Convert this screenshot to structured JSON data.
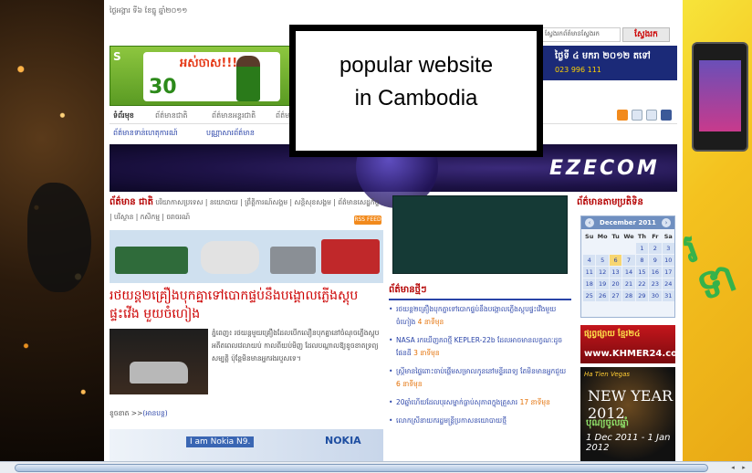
{
  "overlay": {
    "line1": "popular website",
    "line2": "in Cambodia"
  },
  "topbar": {
    "date": "ថ្ងៃអង្គារ ទី៦ ខែធ្នូ ឆ្នាំ២០១១"
  },
  "search": {
    "placeholder": "ស្វែងរកព័ត៌មានស្វែងរក",
    "button": "ស្វែងរក"
  },
  "banner_left": {
    "s": "S",
    "headline": "អស់ចាស!!!",
    "big": "30"
  },
  "banner_right": {
    "line1": "ថ្ងៃទី ៤ មករា ២០១២ តទៅ",
    "line2": "023 996 111"
  },
  "nav": {
    "items": [
      "ទំព័រមុខ",
      "ព័ត៌មានជាតិ",
      "ព័ត៌មានអន្តរជាតិ",
      "ព័ត៌មា"
    ],
    "sub": [
      "ព័ត៌មានទាន់ហេតុការណ៍",
      "បណ្ណាសារព័ត៌មាន"
    ]
  },
  "ezecom": {
    "logo": "EZECOM"
  },
  "left": {
    "cat_title": "ព័ត៌មាន ជាតិ",
    "cat_links": "បរិយាកាសប្រទេស | នយោបាយ | ព្រឹត្តិការណ៍សង្គម | សន្តិសុខសង្គម | ព័ត៌មានសេដ្ឋកិច្ច | បរិស្ថាន | កសិកម្ម | ចរាចរណ៍",
    "rss": "RSS FEED",
    "headline": "រថយន្ត២គ្រឿងបុកគ្នាទៅបោកផ្ទប់នឹងបង្គោលភ្លើងស្តុបផ្ទះវើង មួយចំហៀង",
    "story": "ភ្នំពេញ៖ រថយន្តមួយគ្រឿងដែលបើកលឿនបុកគ្នានៅចំណុចភ្លើងស្តុប អតីតពេលវេលាយប់ កាលពីយប់មិញ ដែលបណ្តាលឱ្យខូចខាតទ្រព្យសម្បត្តិ ប៉ុន្តែមិនមានអ្នករងរបួសទេ។",
    "more_prefix": "ខូចខាត >>",
    "more_link": "(អានបន្ត)",
    "nokia_t1": "I am Nokia N9.",
    "nokia_brand": "NOKIA"
  },
  "middle": {
    "title": "ព័ត៌មានថ្មីៗ",
    "news": [
      {
        "text": "រថយន្ត២គ្រឿងបុកគ្នាទៅបោកផ្ទប់នឹងបង្គោលភ្លើងស្តុបផ្ទះវើងមួយចំហៀង",
        "ago": "4 នាទីមុន"
      },
      {
        "text": "NASA រកឃើញភពថ្មី KEPLER-22b ដែលអាចមានលក្ខណៈដូចផែនដី",
        "ago": "3 នាទីមុន"
      },
      {
        "text": "ស្ត្រីមានផ្ទៃពោះចាប់ផ្តើមសម្រាលកូននៅមន្ទីរពេទ្យ តែមិនមានអ្នកជួយ",
        "ago": "6 នាទីមុន"
      },
      {
        "text": "20ឆ្នាំហើយដែលបុរសម្នាក់ធ្លាប់សុភាពក្នុងគ្រួសារ",
        "ago": "17 នាទីមុន"
      },
      {
        "text": "លោកស្រីនាយករដ្ឋមន្ត្រីប្រកាសនយោបាយថ្មី",
        "ago": ""
      }
    ]
  },
  "right": {
    "title": "ព័ត៌មានតាមប្រតិទិន",
    "calendar": {
      "month": "December 2011",
      "dow": [
        "Su",
        "Mo",
        "Tu",
        "We",
        "Th",
        "Fr",
        "Sa"
      ],
      "days": [
        [
          "",
          "",
          "",
          "",
          "1",
          "2",
          "3"
        ],
        [
          "4",
          "5",
          "6",
          "7",
          "8",
          "9",
          "10"
        ],
        [
          "11",
          "12",
          "13",
          "14",
          "15",
          "16",
          "17"
        ],
        [
          "18",
          "19",
          "20",
          "21",
          "22",
          "23",
          "24"
        ],
        [
          "25",
          "26",
          "27",
          "28",
          "29",
          "30",
          "31"
        ]
      ],
      "today": "6"
    },
    "ad1_top": "ផ្សព្វផ្សាយ ខ្មែរ២៤",
    "ad1_bottom": "www.KHMER24.com",
    "ad2_top": "Ha Tien Vegas",
    "ad2_ny": "NEW YEAR 2012",
    "ad2_kh": "បុណ្យចូលឆ្នាំ",
    "ad2_dates": "1 Dec 2011 - 1 Jan 2012"
  },
  "colors": {
    "accent": "#b40000",
    "link": "#2a44a8"
  }
}
